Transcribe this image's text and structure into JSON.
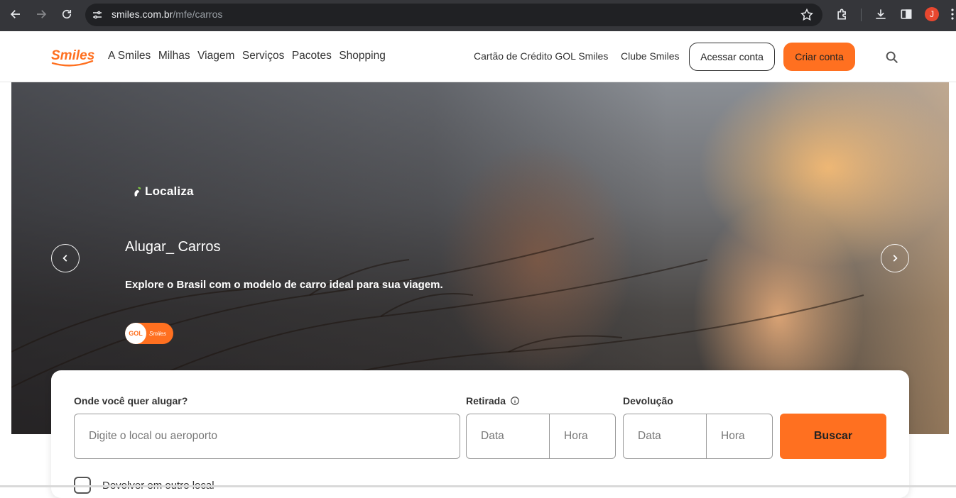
{
  "browser": {
    "url_host": "smiles.com.br",
    "url_path": "/mfe/carros",
    "profile_initial": "J",
    "profile_color": "#e8472f",
    "icons": [
      "back-icon",
      "forward-icon",
      "reload-icon",
      "site-settings-icon",
      "star-icon",
      "extensions-icon",
      "download-icon",
      "side-panel-icon",
      "menu-icon"
    ]
  },
  "header": {
    "logo_text": "Smiles",
    "nav": [
      "A Smiles",
      "Milhas",
      "Viagem",
      "Serviços",
      "Pacotes",
      "Shopping"
    ],
    "cartao": "Cartão de Crédito GOL Smiles",
    "clube": "Clube Smiles",
    "acessar": "Acessar conta",
    "criar": "Criar conta",
    "accent": "#ff7020"
  },
  "hero": {
    "partner": "Localiza",
    "title": "Alugar_ Carros",
    "subtitle": "Explore o Brasil com o modelo de carro ideal para sua viagem.",
    "badge_left": "GOL",
    "badge_right": "Smiles"
  },
  "search": {
    "where_label": "Onde você quer alugar?",
    "where_placeholder": "Digite o local ou aeroporto",
    "pickup_label": "Retirada",
    "return_label": "Devolução",
    "date_placeholder": "Data",
    "time_placeholder": "Hora",
    "search_button": "Buscar",
    "other_location": "Devolver em outro local"
  }
}
